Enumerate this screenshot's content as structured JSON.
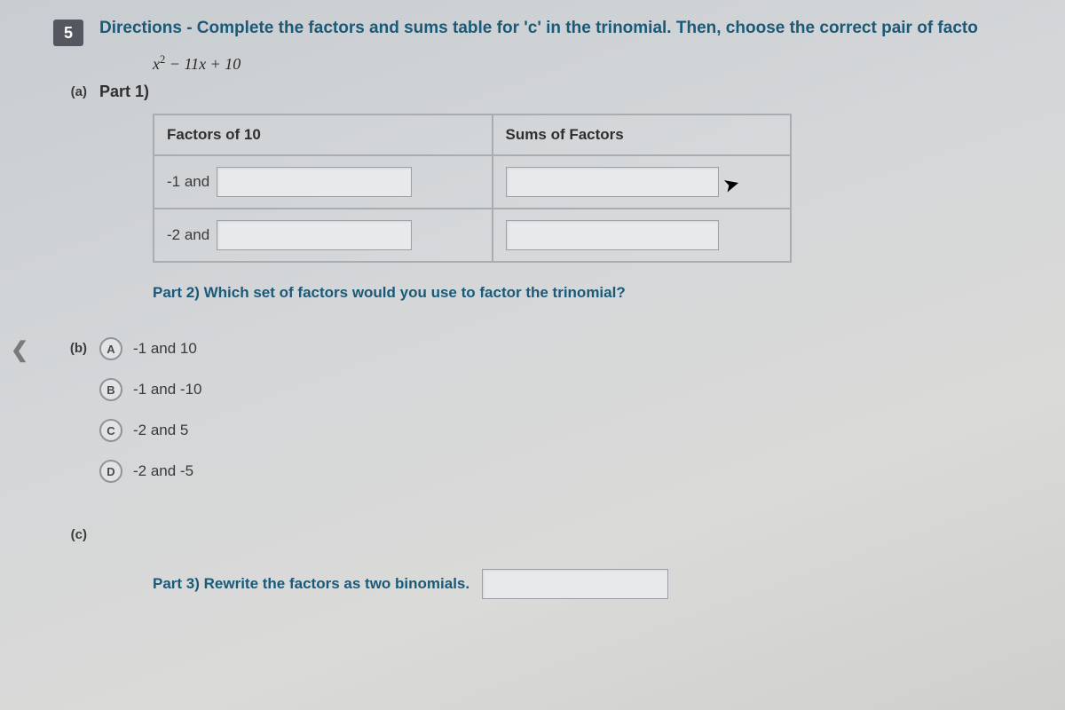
{
  "question_number": "5",
  "directions": "Directions - Complete the factors and sums table for 'c' in the trinomial. Then, choose the correct pair of facto",
  "trinomial_html": "x² − 11x + 10",
  "parts": {
    "a": {
      "marker": "(a)",
      "label": "Part 1)",
      "table": {
        "header_left": "Factors of 10",
        "header_right": "Sums of Factors",
        "rows": [
          {
            "prefix": "-1 and"
          },
          {
            "prefix": "-2 and"
          }
        ]
      },
      "part2_text": "Part 2) Which set of factors would you use to factor the trinomial?"
    },
    "b": {
      "marker": "(b)",
      "choices": [
        {
          "letter": "A",
          "text": "-1 and 10"
        },
        {
          "letter": "B",
          "text": "-1 and -10"
        },
        {
          "letter": "C",
          "text": "-2 and 5"
        },
        {
          "letter": "D",
          "text": "-2 and -5"
        }
      ]
    },
    "c": {
      "marker": "(c)",
      "part3_text": "Part 3) Rewrite the factors as two binomials."
    }
  }
}
